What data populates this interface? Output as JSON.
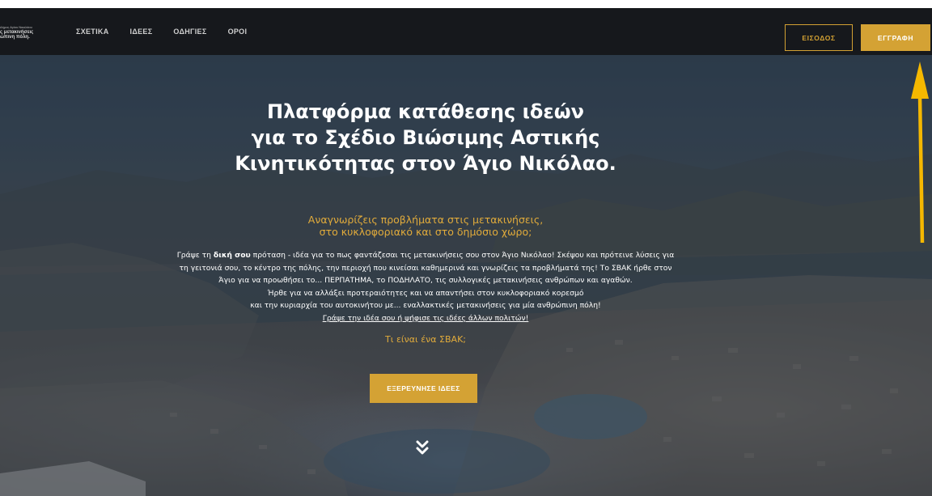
{
  "logo": {
    "line1": "Δήμος Αγίου Νικολάου",
    "line2": "ς μετακινήσεις",
    "line3": "ώπινη πόλη."
  },
  "nav": {
    "items": [
      {
        "label": "ΣΧΕΤΙΚΑ"
      },
      {
        "label": "ΙΔΕΕΣ"
      },
      {
        "label": "ΟΔΗΓΙΕΣ"
      },
      {
        "label": "ΟΡΟΙ"
      }
    ],
    "login_label": "ΕΙΣΟΔΟΣ",
    "register_label": "ΕΓΓΡΑΦΗ"
  },
  "hero": {
    "title_lines": [
      "Πλατφόρμα κατάθεσης ιδεών",
      "για το Σχέδιο Βιώσιμης Αστικής",
      "Κινητικότητας στον Άγιο Νικόλαο."
    ],
    "subtitle_lines": [
      "Αναγνωρίζεις προβλήματα στις μετακινήσεις,",
      "στο κυκλοφοριακό και στο δημόσιο χώρο;"
    ],
    "body": {
      "line1_prefix": "Γράψε τη ",
      "line1_bold": "δική σου",
      "line1_suffix": " πρόταση - ιδέα για το πως φαντάζεσαι τις μετακινήσεις σου στον Άγιο Νικόλαο! Σκέψου και πρότεινε λύσεις για",
      "line2": "τη γειτονιά σου, το κέντρο της πόλης, την περιοχή που κινείσαι καθημερινά και γνωρίζεις τα προβλήματά της! Το ΣΒΑΚ ήρθε στον",
      "line3": "Άγιο για να προωθήσει το... ΠΕΡΠΑΤΗΜΑ, το ΠΟΔΗΛΑΤΟ, τις συλλογικές μετακινήσεις ανθρώπων και αγαθών.",
      "line4": "Ήρθε για να αλλάξει προτεραιότητες και να απαντήσει στον κυκλοφοριακό κορεσμό",
      "line5": "και την κυριαρχία του αυτοκινήτου με... εναλλακτικές μετακινήσεις για μία ανθρώπινη πόλη!",
      "cta_link": "Γράψε την ιδέα σου ή ψήφισε τις ιδέες άλλων πολιτών!"
    },
    "sbak_link": "Τι είναι ένα ΣΒΑΚ;",
    "explore_label": "ΕΞΕΡΕΥΝΗΣΕ ΙΔΕΕΣ"
  },
  "colors": {
    "accent": "#d4a234",
    "navbar": "#16181c",
    "annotation_arrow": "#f5b800"
  },
  "icons": {
    "scroll": "chevron-double-down-icon",
    "annotation": "arrow-up-icon"
  }
}
